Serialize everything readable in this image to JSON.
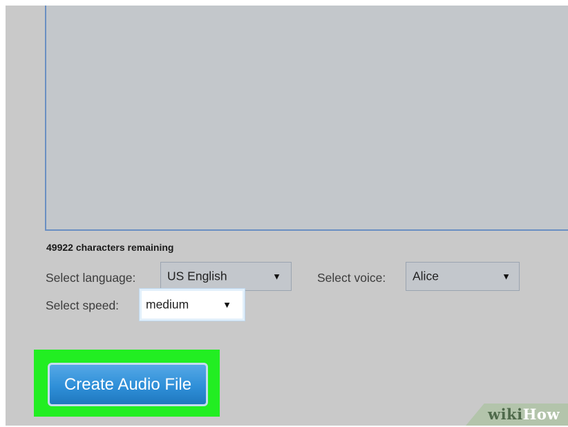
{
  "text_input": {
    "value": ""
  },
  "characters_remaining": "49922 characters remaining",
  "language": {
    "label": "Select language:",
    "selected": "US English"
  },
  "voice": {
    "label": "Select voice:",
    "selected": "Alice"
  },
  "speed": {
    "label": "Select speed:",
    "selected": "medium"
  },
  "create_button": {
    "label": "Create Audio File"
  },
  "dropdown_arrow": "▼",
  "watermark": {
    "part1": "wiki",
    "part2": "How"
  },
  "colors": {
    "page_background": "#c9c9c9",
    "textarea_background": "#c3c7cb",
    "highlight": "#22ee22",
    "button": "#2f8fd8"
  }
}
